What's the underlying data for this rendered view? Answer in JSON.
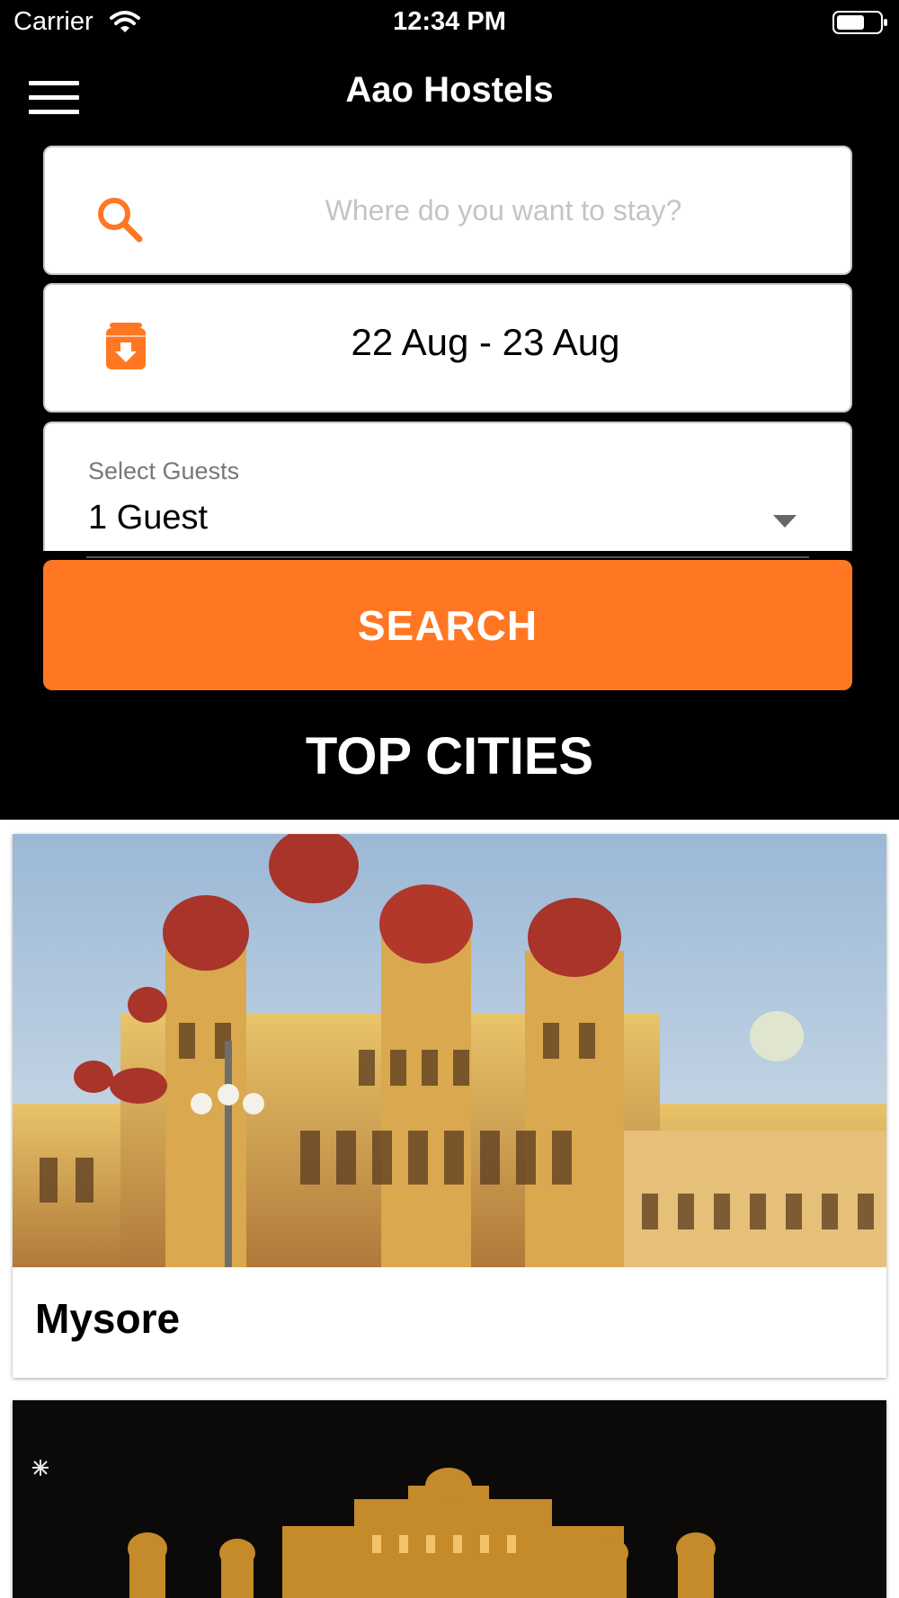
{
  "status_bar": {
    "carrier": "Carrier",
    "time": "12:34 PM"
  },
  "header": {
    "title": "Aao Hostels",
    "menu_icon": "hamburger-menu-icon"
  },
  "search": {
    "placeholder": "Where do you want to stay?",
    "value": "",
    "icon": "search-icon"
  },
  "dates": {
    "value": "22 Aug - 23 Aug",
    "icon": "calendar-icon"
  },
  "guests": {
    "label": "Select Guests",
    "value": "1 Guest",
    "icon": "chevron-down-icon"
  },
  "search_button": {
    "label": "SEARCH"
  },
  "top_cities": {
    "title": "TOP CITIES",
    "cities": [
      {
        "name": "Mysore"
      }
    ]
  },
  "colors": {
    "accent": "#ff7722",
    "background": "#000000",
    "card": "#ffffff"
  }
}
